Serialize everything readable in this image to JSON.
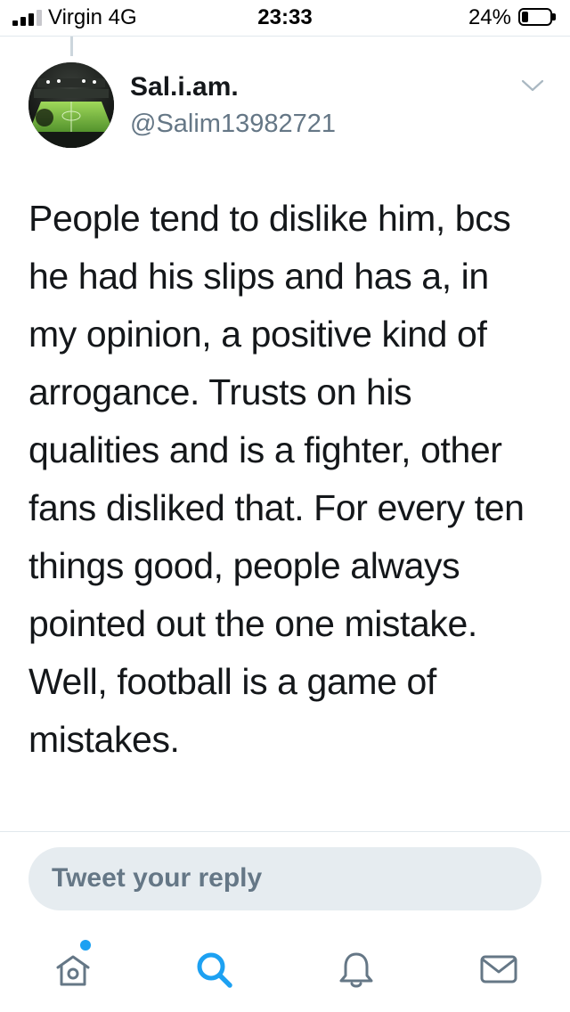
{
  "status_bar": {
    "carrier": "Virgin  4G",
    "time": "23:33",
    "battery_percent_label": "24%",
    "battery_level": 0.24,
    "signal_bars": 3
  },
  "tweet": {
    "display_name": "Sal.i.am.",
    "handle": "@Salim13982721",
    "text": "People tend to dislike him, bcs he had his slips and has a, in my opinion, a positive kind of arrogance. Trusts on his qualities and is a fighter, other fans disliked that. For every ten things good, people always pointed out the one mistake. Well, football is a game of mistakes."
  },
  "reply": {
    "placeholder": "Tweet your reply"
  },
  "tab_bar": {
    "items": [
      {
        "icon": "home-icon",
        "active": false,
        "has_badge": true
      },
      {
        "icon": "search-icon",
        "active": true,
        "has_badge": false
      },
      {
        "icon": "bell-icon",
        "active": false,
        "has_badge": false
      },
      {
        "icon": "mail-icon",
        "active": false,
        "has_badge": false
      }
    ]
  },
  "colors": {
    "accent": "#1da1f2",
    "icon_gray": "#657786",
    "text": "#14171a",
    "reply_bg": "#e6ecf0"
  }
}
